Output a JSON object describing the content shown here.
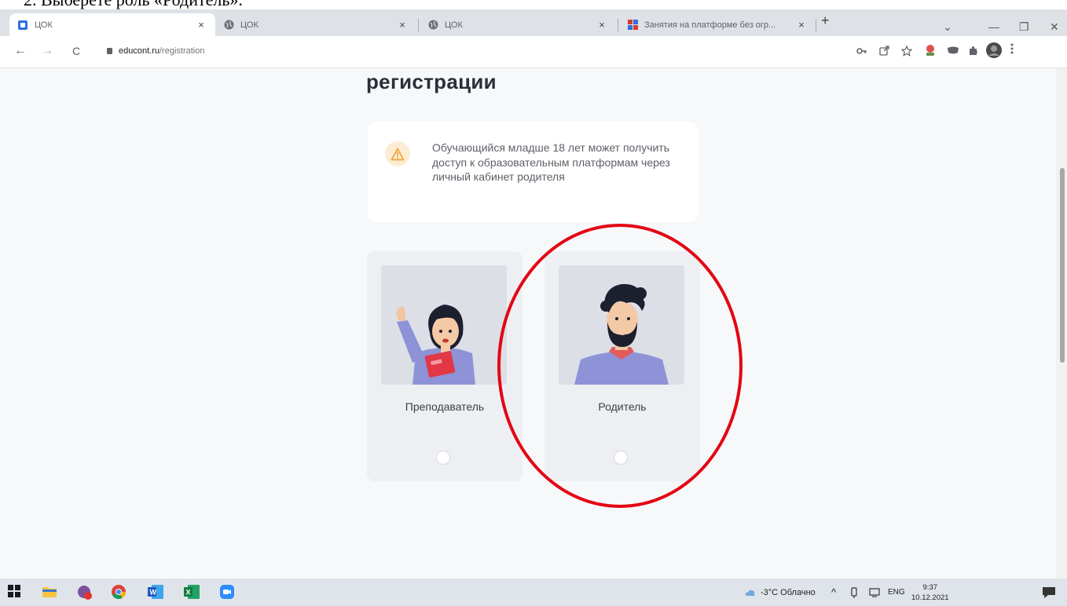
{
  "doc_caption": "2.  Выберете роль «Родитель».",
  "browser": {
    "tabs": [
      {
        "title": "ЦОК",
        "active": true
      },
      {
        "title": "ЦОК",
        "active": false
      },
      {
        "title": "ЦОК",
        "active": false
      },
      {
        "title": "Занятия на платформе без огр...",
        "active": false
      }
    ],
    "close_glyph": "×",
    "new_tab_glyph": "+",
    "window_controls": {
      "dropdown": "⌄",
      "minimize": "—",
      "restore": "❐",
      "close": "✕"
    },
    "nav": {
      "back": "←",
      "forward": "→",
      "reload": "C"
    },
    "url": {
      "host": "educont.ru",
      "path": "/registration"
    }
  },
  "page": {
    "title": "регистрации",
    "notice": {
      "icon": "warning-icon",
      "text": "Обучающийся младше 18 лет может получить доступ к образовательным платформам через личный кабинет родителя"
    },
    "roles": [
      {
        "label": "Преподаватель",
        "selected": false
      },
      {
        "label": "Родитель",
        "selected": false
      }
    ],
    "highlight_color": "#e30613"
  },
  "taskbar": {
    "weather": "-3°C Облачно",
    "lang": "ENG",
    "time": "9:37",
    "date": "10.12.2021",
    "tray_up": "^"
  }
}
